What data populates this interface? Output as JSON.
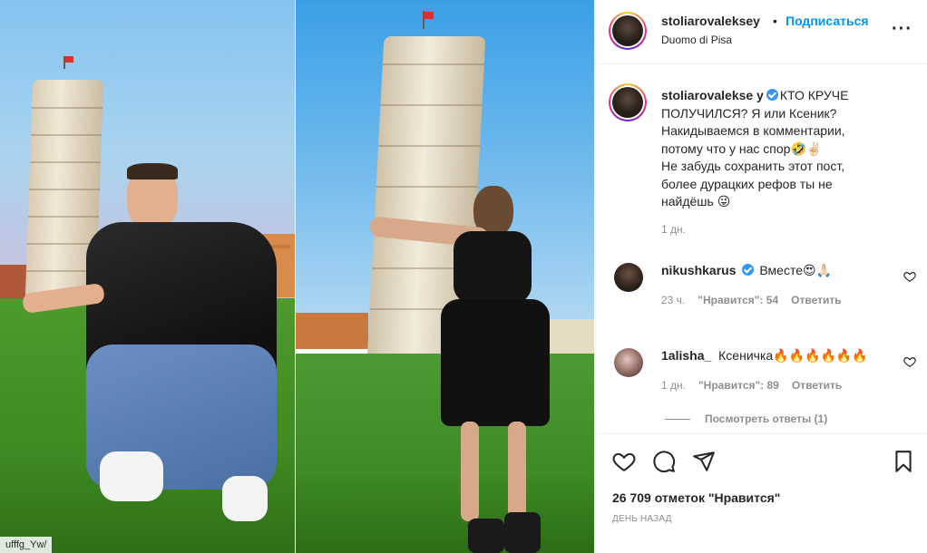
{
  "post": {
    "author": "stoliaroval​ekse​y",
    "follow_label": "Подписаться",
    "separator": "•",
    "location": "Duomo di Pisa",
    "more_icon": "more-options-icon",
    "watermark": "ufffg_Yw/"
  },
  "caption": {
    "author": "stoliarovalekse y",
    "lines": [
      "КТО КРУЧЕ",
      "ПОЛУЧИЛСЯ? Я или Ксеник?",
      "Накидываемся в комментарии,",
      "потому что у нас спор🤣✌🏻",
      "Не забудь сохранить этот пост,",
      "более дурацких рефов ты не",
      "найдёшь 😜"
    ],
    "time": "1 дн."
  },
  "comments": [
    {
      "user": "nikushkarus",
      "verified": true,
      "text": "Вместе😍🙏🏻",
      "time": "23 ч.",
      "likes": "\"Нравится\": 54",
      "reply": "Ответить"
    },
    {
      "user": "1alisha_",
      "verified": false,
      "text": "Ксеничка🔥🔥🔥🔥🔥🔥",
      "time": "1 дн.",
      "likes": "\"Нравится\": 89",
      "reply": "Ответить"
    }
  ],
  "view_replies": "Посмотреть ответы (1)",
  "actions": {
    "likes_text": "26 709 отметок \"Нравится\"",
    "time_ago": "ДЕНЬ НАЗАД"
  },
  "colors": {
    "accent": "#0095f6",
    "verified": "#3897f0",
    "muted": "#8e8e8e",
    "text": "#262626"
  }
}
